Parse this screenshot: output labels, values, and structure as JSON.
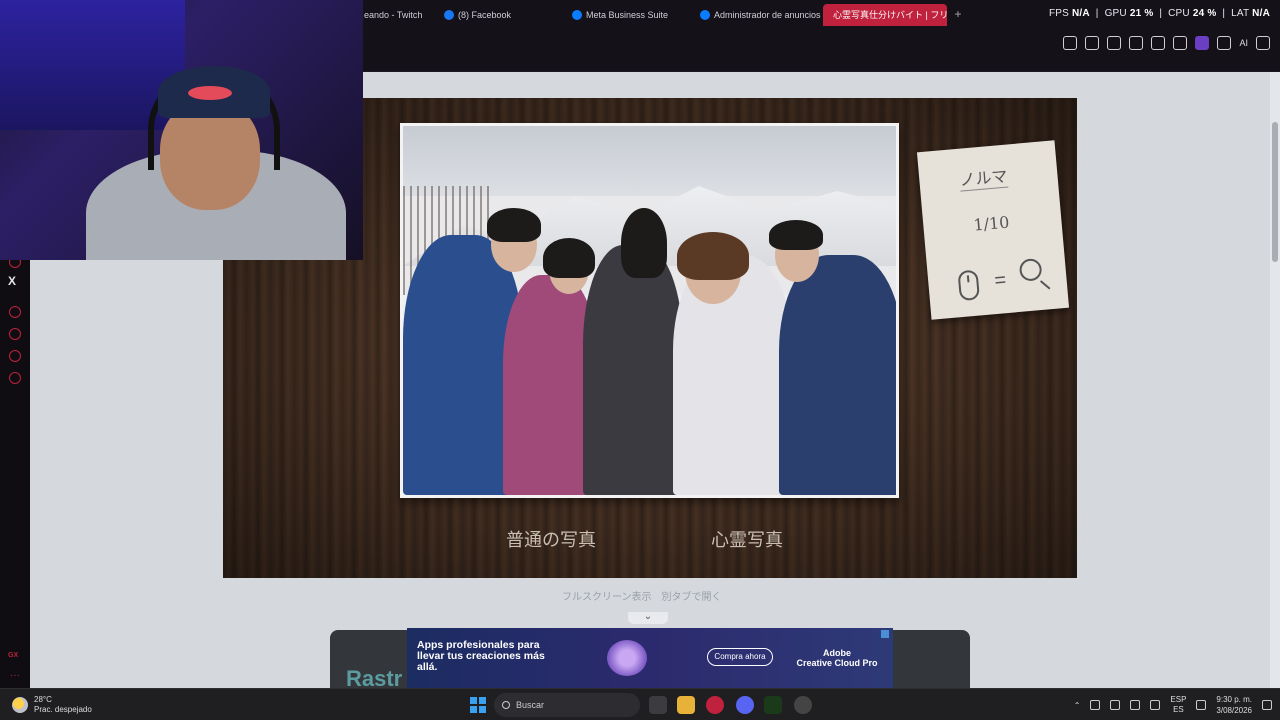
{
  "browser": {
    "tabs": [
      {
        "label": "eando - Twitch",
        "color": "#9146ff",
        "active": false
      },
      {
        "label": "(8) Facebook",
        "color": "#1877f2",
        "active": false
      },
      {
        "label": "Meta Business Suite",
        "color": "#0a7cff",
        "active": false
      },
      {
        "label": "Administrador de anuncios",
        "color": "#0a7cff",
        "active": false
      },
      {
        "label": "心霊写真仕分けバイト | フリーゲ",
        "color": "#e0a040",
        "active": true
      }
    ],
    "new_tab": "+",
    "stats": {
      "fps_label": "FPS",
      "fps_value": "N/A",
      "gpu_label": "GPU",
      "gpu_value": "21 %",
      "cpu_label": "CPU",
      "cpu_value": "24 %",
      "lat_label": "LAT",
      "lat_value": "N/A"
    },
    "toolbar": {
      "ai_label": "AI"
    }
  },
  "game": {
    "caption_normal": "普通の写真",
    "caption_ghost": "心霊写真",
    "note_title": "ノルマ",
    "note_count": "1/10",
    "note_equals": "="
  },
  "page_links": {
    "fullscreen": "フルスクリーン表示",
    "new_tab": "別タブで開く",
    "partial_title": "Rastr"
  },
  "ad": {
    "headline": "Apps profesionales para llevar tus creaciones más allá.",
    "cta": "Compra ahora",
    "brand_line1": "Adobe",
    "brand_line2": "Creative Cloud Pro"
  },
  "sidebar": {
    "x_label": "X",
    "gx_label": "GX",
    "more": "···"
  },
  "taskbar": {
    "temp": "28°C",
    "weather": "Prac. despejado",
    "search_placeholder": "Buscar",
    "lang1": "ESP",
    "lang2": "ES",
    "time": "9:30 p. m.",
    "date": "3/08/2026"
  },
  "colors": {
    "accent": "#c0213c",
    "page_bg": "#d5d8dd",
    "taskbar": "#1f1f22"
  }
}
